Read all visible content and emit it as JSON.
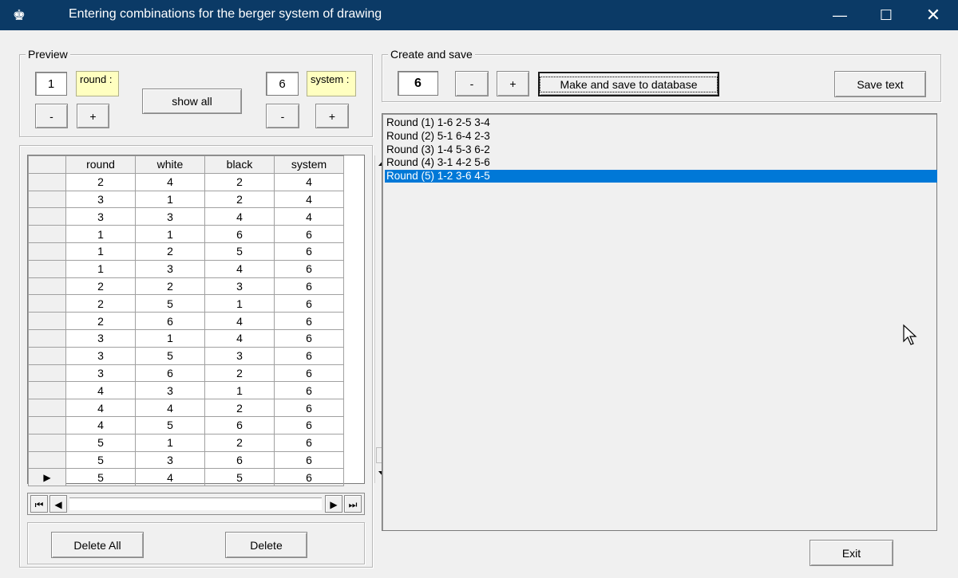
{
  "window": {
    "title": "Entering combinations for the berger system of drawing",
    "title_bar_color": "#0b3a66",
    "controls": {
      "minimize": "—",
      "maximize": "☐",
      "close": "✕"
    }
  },
  "preview": {
    "title": "Preview",
    "round_value": "1",
    "round_label": "round :",
    "system_value": "6",
    "system_label": "system :",
    "show_all_label": "show all",
    "minus_label": "-",
    "plus_label": "+"
  },
  "grid": {
    "columns": [
      "round",
      "white",
      "black",
      "system"
    ],
    "rows": [
      [
        "2",
        "4",
        "2",
        "4"
      ],
      [
        "3",
        "1",
        "2",
        "4"
      ],
      [
        "3",
        "3",
        "4",
        "4"
      ],
      [
        "1",
        "1",
        "6",
        "6"
      ],
      [
        "1",
        "2",
        "5",
        "6"
      ],
      [
        "1",
        "3",
        "4",
        "6"
      ],
      [
        "2",
        "2",
        "3",
        "6"
      ],
      [
        "2",
        "5",
        "1",
        "6"
      ],
      [
        "2",
        "6",
        "4",
        "6"
      ],
      [
        "3",
        "1",
        "4",
        "6"
      ],
      [
        "3",
        "5",
        "3",
        "6"
      ],
      [
        "3",
        "6",
        "2",
        "6"
      ],
      [
        "4",
        "3",
        "1",
        "6"
      ],
      [
        "4",
        "4",
        "2",
        "6"
      ],
      [
        "4",
        "5",
        "6",
        "6"
      ],
      [
        "5",
        "1",
        "2",
        "6"
      ],
      [
        "5",
        "3",
        "6",
        "6"
      ],
      [
        "5",
        "4",
        "5",
        "6"
      ]
    ],
    "current_row_indicator": "▶"
  },
  "navigator": {
    "first": "⏮",
    "prior": "◀",
    "next": "▶",
    "last": "⏭"
  },
  "bottom_left": {
    "delete_all_label": "Delete All",
    "delete_label": "Delete"
  },
  "create_save": {
    "title": "Create and save",
    "value": "6",
    "minus_label": "-",
    "plus_label": "+",
    "make_save_label": "Make and save to database",
    "save_text_label": "Save text"
  },
  "rounds_list": {
    "items": [
      "Round (1) 1-6 2-5 3-4",
      "Round (2) 5-1 6-4 2-3",
      "Round (3) 1-4 5-3 6-2",
      "Round (4) 3-1 4-2 5-6",
      "Round (5) 1-2 3-6 4-5"
    ],
    "selected_index": 4,
    "selection_color": "#0078d7"
  },
  "exit_label": "Exit"
}
